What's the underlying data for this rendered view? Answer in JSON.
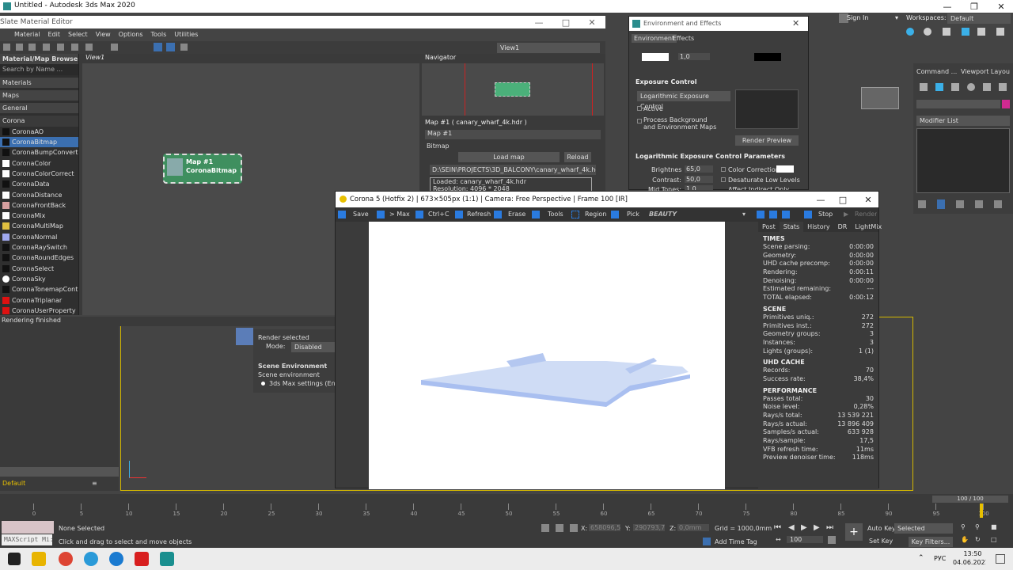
{
  "app": {
    "title": "Untitled - Autodesk 3ds Max 2020",
    "sign_in": "Sign In",
    "workspaces_label": "Workspaces:",
    "workspace": "Default"
  },
  "slate": {
    "title": "Slate Material Editor",
    "menu": [
      "Material",
      "Edit",
      "Select",
      "View",
      "Options",
      "Tools",
      "Utilities"
    ],
    "view_dropdown": "View1",
    "browser_title": "Material/Map Browser",
    "search": "Search by Name ...",
    "groups": [
      "Materials",
      "Maps",
      "General",
      "Corona"
    ],
    "items": [
      {
        "label": "CoronaAO",
        "color": "#111111"
      },
      {
        "label": "CoronaBitmap",
        "color": "#111111",
        "selected": true
      },
      {
        "label": "CoronaBumpConverter",
        "color": "#111111"
      },
      {
        "label": "CoronaColor",
        "color": "#ffffff"
      },
      {
        "label": "CoronaColorCorrect",
        "color": "#ffffff"
      },
      {
        "label": "CoronaData",
        "color": "#111111"
      },
      {
        "label": "CoronaDistance",
        "color": "#ffffff"
      },
      {
        "label": "CoronaFrontBack",
        "color": "#d8a0a0"
      },
      {
        "label": "CoronaMix",
        "color": "#ffffff"
      },
      {
        "label": "CoronaMultiMap",
        "color": "#e0c040"
      },
      {
        "label": "CoronaNormal",
        "color": "#9fa8f0"
      },
      {
        "label": "CoronaRaySwitch",
        "color": "#111111"
      },
      {
        "label": "CoronaRoundEdges",
        "color": "#111111"
      },
      {
        "label": "CoronaSelect",
        "color": "#111111"
      },
      {
        "label": "CoronaSky",
        "color": "#ffffff"
      },
      {
        "label": "CoronaTonemapControl",
        "color": "#111111"
      },
      {
        "label": "CoronaTriplanar",
        "color": "#dd1111"
      },
      {
        "label": "CoronaUserProperty",
        "color": "#dd1111"
      }
    ],
    "view_tab": "View1",
    "node_title": "Map #1",
    "node_sub": "CoronaBitmap",
    "navigator": "Navigator",
    "params_title": "Map #1 ( canary_wharf_4k.hdr )",
    "params_name": "Map #1",
    "bitmap_label": "Bitmap",
    "load_map": "Load map",
    "reload": "Reload",
    "path": "D:\\SEIN\\PROJECTS\\3D_BALCONY\\canary_wharf_4k.hdr",
    "loaded": "Loaded: canary_wharf_4k.hdr",
    "resolution": "Resolution: 4096 * 2048",
    "status": "Rendering finished"
  },
  "env": {
    "title": "Environment and Effects",
    "tabs": [
      "Environment",
      "Effects"
    ],
    "mult": "1,0",
    "exposure_title": "Exposure Control",
    "exposure_type": "Logarithmic Exposure Control",
    "active": "Active",
    "process_bg": "Process Background",
    "and_env": "and Environment Maps",
    "render_preview": "Render Preview",
    "log_title": "Logarithmic Exposure Control Parameters",
    "brightness_label": "Brightness:",
    "brightness": "65,0",
    "contrast_label": "Contrast:",
    "contrast": "50,0",
    "midtones_label": "Mid Tones:",
    "midtones": "1,0",
    "color_correction": "Color Correction:",
    "desaturate": "Desaturate Low Levels",
    "affect_indirect": "Affect Indirect Only"
  },
  "render_setup": {
    "render_selected": "Render selected",
    "mode_label": "Mode:",
    "mode": "Disabled",
    "scene_env": "Scene Environment",
    "scene_env_sub": "Scene environment",
    "option": "3ds Max settings (Environment)"
  },
  "cmd": {
    "tabs": [
      "Command ...",
      "Viewport Layout..."
    ],
    "modifier_list": "Modifier List"
  },
  "vfb": {
    "title": "Corona 5 (Hotfix 2) | 673×505px (1:1) | Camera: Free Perspective | Frame 100 [IR]",
    "tools": [
      "Save",
      "> Max",
      "Ctrl+C",
      "Refresh",
      "Erase",
      "Tools",
      "Region",
      "Pick"
    ],
    "channel": "BEAUTY",
    "stop": "Stop",
    "render": "Render",
    "tabs": [
      "Post",
      "Stats",
      "History",
      "DR",
      "LightMix"
    ],
    "sections": [
      {
        "title": "TIMES",
        "rows": [
          [
            "Scene parsing:",
            "0:00:00"
          ],
          [
            "Geometry:",
            "0:00:00"
          ],
          [
            "UHD cache precomp:",
            "0:00:00"
          ],
          [
            "Rendering:",
            "0:00:11"
          ],
          [
            "Denoising:",
            "0:00:00"
          ],
          [
            "Estimated remaining:",
            "---"
          ],
          [
            "TOTAL elapsed:",
            "0:00:12"
          ]
        ]
      },
      {
        "title": "SCENE",
        "rows": [
          [
            "Primitives uniq.:",
            "272"
          ],
          [
            "Primitives inst.:",
            "272"
          ],
          [
            "Geometry groups:",
            "3"
          ],
          [
            "Instances:",
            "3"
          ],
          [
            "Lights (groups):",
            "1 (1)"
          ]
        ]
      },
      {
        "title": "UHD CACHE",
        "rows": [
          [
            "Records:",
            "70"
          ],
          [
            "Success rate:",
            "38,4%"
          ]
        ]
      },
      {
        "title": "PERFORMANCE",
        "rows": [
          [
            "Passes total:",
            "30"
          ],
          [
            "Noise level:",
            "0,28%"
          ],
          [
            "Rays/s total:",
            "13 539 221"
          ],
          [
            "Rays/s actual:",
            "13 896 409"
          ],
          [
            "Samples/s actual:",
            "633 928"
          ],
          [
            "Rays/sample:",
            "17,5"
          ],
          [
            "VFB refresh time:",
            "11ms"
          ],
          [
            "Preview denoiser time:",
            "118ms"
          ]
        ]
      }
    ]
  },
  "timeline": {
    "frame": "100 / 100",
    "ticks": [
      "0",
      "5",
      "10",
      "15",
      "20",
      "25",
      "30",
      "35",
      "40",
      "45",
      "50",
      "55",
      "60",
      "65",
      "70",
      "75",
      "80",
      "85",
      "90",
      "95",
      "100"
    ]
  },
  "statusbar": {
    "maxscript": "MAXScript Mi:",
    "none_selected": "None Selected",
    "hint": "Click and drag to select and move objects",
    "x_label": "X:",
    "x": "658096,5m",
    "y_label": "Y:",
    "y": "290793,7m",
    "z_label": "Z:",
    "z": "0,0mm",
    "grid": "Grid = 1000,0mm",
    "add_time_tag": "Add Time Tag",
    "frame": "100",
    "auto_key": "Auto Key",
    "selected": "Selected",
    "set_key": "Set Key",
    "key_filters": "Key Filters...",
    "default_layer": "Default"
  },
  "taskbar": {
    "lang": "РУС",
    "time": "13:50",
    "date": "04.06.2021"
  }
}
